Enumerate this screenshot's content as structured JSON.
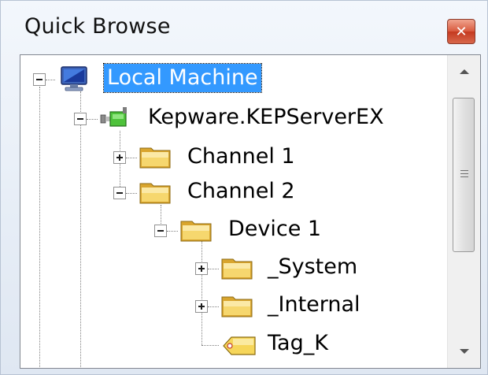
{
  "window": {
    "title": "Quick Browse",
    "close_icon": "close-icon"
  },
  "tree": {
    "local_machine": {
      "label": "Local Machine",
      "icon": "computer-icon",
      "selected": true
    },
    "server": {
      "label": "Kepware.KEPServerEX",
      "icon": "server-plug-icon"
    },
    "channel1": {
      "label": "Channel 1",
      "icon": "folder-icon",
      "expanded": false
    },
    "channel2": {
      "label": "Channel 2",
      "icon": "folder-icon",
      "expanded": true
    },
    "device1": {
      "label": "Device 1",
      "icon": "folder-icon",
      "expanded": true
    },
    "system": {
      "label": "_System",
      "icon": "folder-icon",
      "expanded": false
    },
    "internal": {
      "label": "_Internal",
      "icon": "folder-icon",
      "expanded": false
    },
    "tag_k": {
      "label": "Tag_K",
      "icon": "tag-icon"
    }
  },
  "colors": {
    "selection": "#3399ff",
    "close_button": "#d8583d",
    "folder": "#f3c94f"
  }
}
